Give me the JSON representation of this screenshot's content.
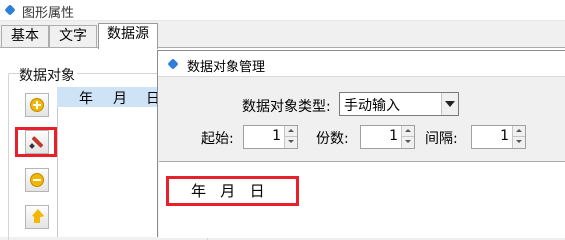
{
  "window": {
    "title": "图形属性"
  },
  "tabs": [
    {
      "label": "基本"
    },
    {
      "label": "文字"
    },
    {
      "label": "数据源",
      "active": true
    }
  ],
  "data_object_group": {
    "label": "数据对象",
    "list_header": [
      "年",
      "月",
      "日"
    ],
    "buttons": [
      "add-icon",
      "edit-icon",
      "remove-icon",
      "move-up-icon"
    ]
  },
  "dialog": {
    "title": "数据对象管理",
    "type_label": "数据对象类型:",
    "type_value": "手动输入",
    "start_label": "起始:",
    "start_value": "1",
    "count_label": "份数:",
    "count_value": "1",
    "interval_label": "间隔:",
    "interval_value": "1",
    "preview_text": "年   月   日"
  },
  "colors": {
    "highlight": "#e8202a",
    "list_header_bg": "#cfe3f7",
    "icon_gold": "#f2b705"
  }
}
